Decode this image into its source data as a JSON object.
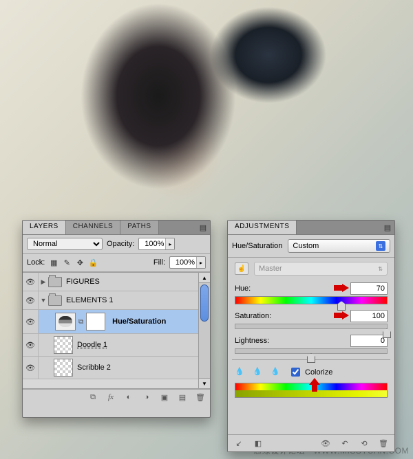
{
  "watermark": "思缘设计论坛 - WWW.MISSYUAN.COM",
  "layers_panel": {
    "tabs": [
      "LAYERS",
      "CHANNELS",
      "PATHS"
    ],
    "active_tab": 0,
    "blend_mode": "Normal",
    "opacity_label": "Opacity:",
    "opacity_value": "100%",
    "lock_label": "Lock:",
    "fill_label": "Fill:",
    "fill_value": "100%",
    "layers": [
      {
        "type": "group",
        "name": "FIGURES",
        "open": false
      },
      {
        "type": "group",
        "name": "ELEMENTS 1",
        "open": true
      },
      {
        "type": "adjustment",
        "name": "Hue/Saturation",
        "selected": true
      },
      {
        "type": "layer",
        "name": "Doodle 1"
      },
      {
        "type": "layer",
        "name": "Scribble 2"
      }
    ]
  },
  "adjustments_panel": {
    "tab": "ADJUSTMENTS",
    "title": "Hue/Saturation",
    "preset": "Custom",
    "channel": "Master",
    "hue_label": "Hue:",
    "hue_value": "70",
    "hue_pos_pct": 70,
    "saturation_label": "Saturation:",
    "saturation_value": "100",
    "saturation_pos_pct": 100,
    "lightness_label": "Lightness:",
    "lightness_value": "0",
    "lightness_pos_pct": 50,
    "colorize_label": "Colorize",
    "colorize_checked": true
  }
}
